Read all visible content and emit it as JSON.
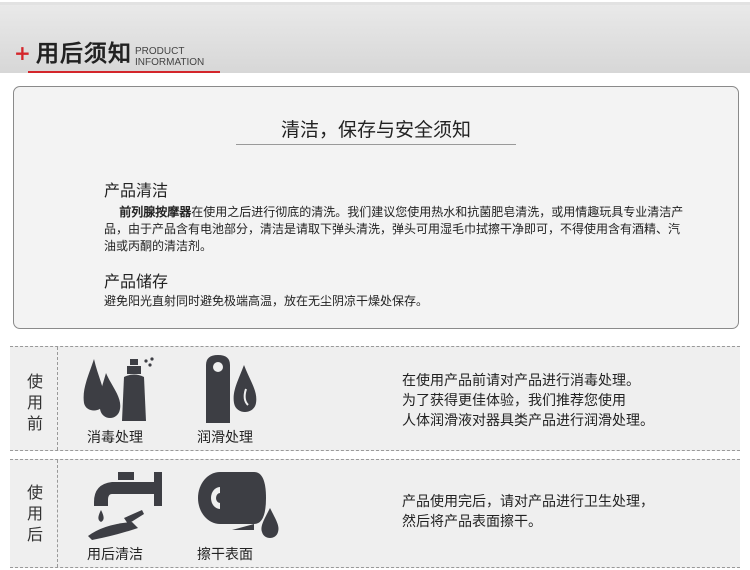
{
  "header": {
    "plus": "+",
    "title": "用后须知",
    "subtitle_line1": "PRODUCT",
    "subtitle_line2": "INFORMATION"
  },
  "info": {
    "title": "清洁，保存与安全须知",
    "cleaning": {
      "heading": "产品清洁",
      "bold_lead": "前列腺按摩器",
      "text": "在使用之后进行彻底的清洗。我们建议您使用热水和抗菌肥皂清洗，或用情趣玩具专业清洁产品，由于产品含有电池部分，清洁是请取下弹头清洗，弹头可用湿毛巾拭擦干净即可，不得使用含有酒精、汽油或丙酮的清洁剂。"
    },
    "storage": {
      "heading": "产品储存",
      "text": "避免阳光直射同时避免极端高温，放在无尘阴凉干燥处保存。"
    }
  },
  "before_use": {
    "label": [
      "使",
      "用",
      "前"
    ],
    "steps": [
      {
        "icon": "disinfect-spray-icon",
        "label": "消毒处理"
      },
      {
        "icon": "lubricant-icon",
        "label": "润滑处理"
      }
    ],
    "text": [
      "在使用产品前请对产品进行消毒处理。",
      "为了获得更佳体验，我们推荐您使用",
      "人体润滑液对器具类产品进行润滑处理。"
    ]
  },
  "after_use": {
    "label": [
      "使",
      "用",
      "后"
    ],
    "steps": [
      {
        "icon": "faucet-wash-icon",
        "label": "用后清洁"
      },
      {
        "icon": "paper-roll-icon",
        "label": "擦干表面"
      }
    ],
    "text": [
      "产品使用完后，请对产品进行卫生处理，",
      "然后将产品表面擦干。"
    ]
  },
  "colors": {
    "accent": "#d4262b",
    "icon": "#3d3e44",
    "panel_bg": "#efefef"
  }
}
